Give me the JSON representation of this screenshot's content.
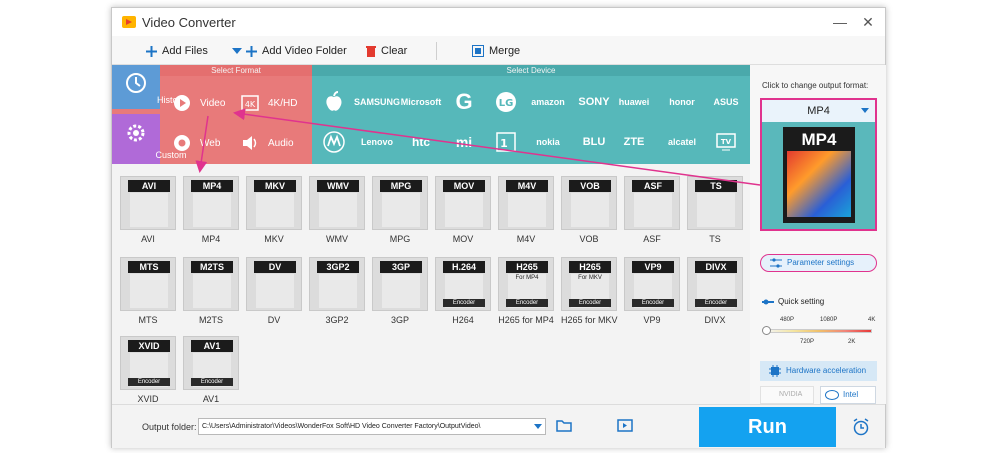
{
  "window": {
    "title": "Video Converter"
  },
  "toolbar": {
    "add_files": "Add Files",
    "add_video_folder": "Add Video Folder",
    "clear": "Clear",
    "merge": "Merge"
  },
  "format_section": {
    "title": "Select Format",
    "history": "History",
    "custom": "Custom",
    "video": "Video",
    "hd": "4K/HD",
    "web": "Web",
    "audio": "Audio"
  },
  "device_section": {
    "title": "Select Device"
  },
  "brands": [
    "SAMSUNG",
    "Microsoft",
    "huawei",
    "amazon",
    "SONY",
    "honor",
    "ASUS",
    "Lenovo",
    "htc",
    "nokia",
    "BLU",
    "ZTE",
    "alcatel"
  ],
  "formats": [
    {
      "cap": "AVI",
      "label": "AVI"
    },
    {
      "cap": "MP4",
      "label": "MP4"
    },
    {
      "cap": "MKV",
      "label": "MKV"
    },
    {
      "cap": "WMV",
      "label": "WMV"
    },
    {
      "cap": "MPG",
      "label": "MPG"
    },
    {
      "cap": "MOV",
      "label": "MOV"
    },
    {
      "cap": "M4V",
      "label": "M4V"
    },
    {
      "cap": "VOB",
      "label": "VOB"
    },
    {
      "cap": "ASF",
      "label": "ASF"
    },
    {
      "cap": "TS",
      "label": "TS"
    },
    {
      "cap": "MTS",
      "label": "MTS"
    },
    {
      "cap": "M2TS",
      "label": "M2TS"
    },
    {
      "cap": "DV",
      "label": "DV"
    },
    {
      "cap": "3GP2",
      "label": "3GP2"
    },
    {
      "cap": "3GP",
      "label": "3GP"
    },
    {
      "cap": "H.264",
      "label": "H264",
      "enc": "Encoder"
    },
    {
      "cap": "H265",
      "label": "H265 for MP4",
      "enc": "Encoder",
      "sub": "For MP4"
    },
    {
      "cap": "H265",
      "label": "H265 for MKV",
      "enc": "Encoder",
      "sub": "For MKV"
    },
    {
      "cap": "VP9",
      "label": "VP9",
      "enc": "Encoder"
    },
    {
      "cap": "DIVX",
      "label": "DIVX",
      "enc": "Encoder"
    },
    {
      "cap": "XVID",
      "label": "XVID",
      "enc": "Encoder"
    },
    {
      "cap": "AV1",
      "label": "AV1",
      "enc": "Encoder"
    }
  ],
  "right_panel": {
    "hint": "Click to change output format:",
    "selected": "MP4",
    "param_settings": "Parameter settings",
    "quick_setting": "Quick setting",
    "quality_top": [
      "480P",
      "1080P",
      "4K"
    ],
    "quality_bottom": [
      "720P",
      "2K"
    ],
    "quality_level": 0.0,
    "hw_accel": "Hardware acceleration",
    "nvidia": "NVIDIA",
    "intel": "Intel"
  },
  "bottom": {
    "output_label": "Output folder:",
    "output_path": "C:\\Users\\Administrator\\Videos\\WonderFox Soft\\HD Video Converter Factory\\OutputVideo\\",
    "run": "Run"
  },
  "colors": {
    "format_bg": "#e87a7a",
    "device_bg": "#56b8ba",
    "accent": "#e0338e",
    "run_bg": "#14a2f0"
  }
}
